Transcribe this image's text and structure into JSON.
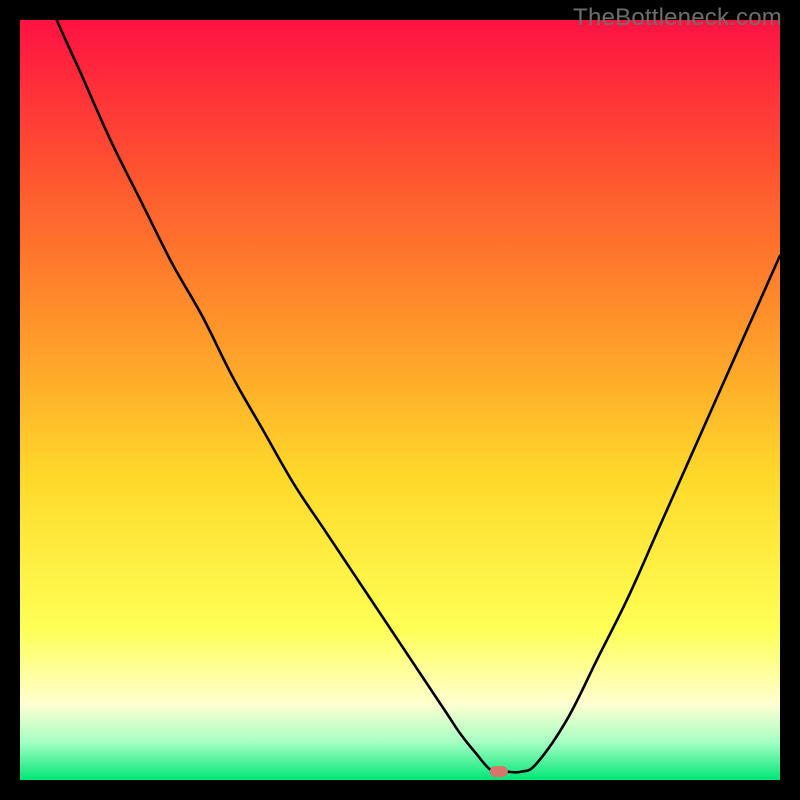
{
  "watermark": "TheBottleneck.com",
  "colors": {
    "gradient_top": "#ff1242",
    "gradient_mid_upper": "#ff8a2a",
    "gradient_mid": "#ffd92a",
    "gradient_lower": "#ffff55",
    "gradient_cream": "#ffffd0",
    "gradient_mint": "#a6ffc4",
    "gradient_green": "#00e676",
    "curve": "#000000",
    "marker": "#d6756a",
    "frame": "#000000"
  },
  "chart_data": {
    "type": "line",
    "title": "",
    "xlabel": "",
    "ylabel": "",
    "xlim": [
      0,
      100
    ],
    "ylim": [
      0,
      100
    ],
    "grid": false,
    "legend": false,
    "marker": {
      "x": 63,
      "y": 1.1,
      "label": ""
    },
    "series": [
      {
        "name": "bottleneck-curve",
        "x": [
          0,
          4,
          8,
          12,
          16,
          20,
          24,
          28,
          32,
          36,
          40,
          44,
          48,
          52,
          56,
          58,
          60,
          62,
          64,
          66,
          68,
          72,
          76,
          80,
          84,
          88,
          92,
          96,
          100
        ],
        "y": [
          113,
          102,
          93,
          84,
          76,
          68,
          61,
          53,
          46,
          39,
          33,
          27,
          21,
          15,
          9,
          6,
          3.5,
          1.3,
          1.1,
          1.1,
          2.2,
          8,
          16,
          24,
          33,
          42,
          51,
          60,
          69
        ]
      }
    ]
  }
}
